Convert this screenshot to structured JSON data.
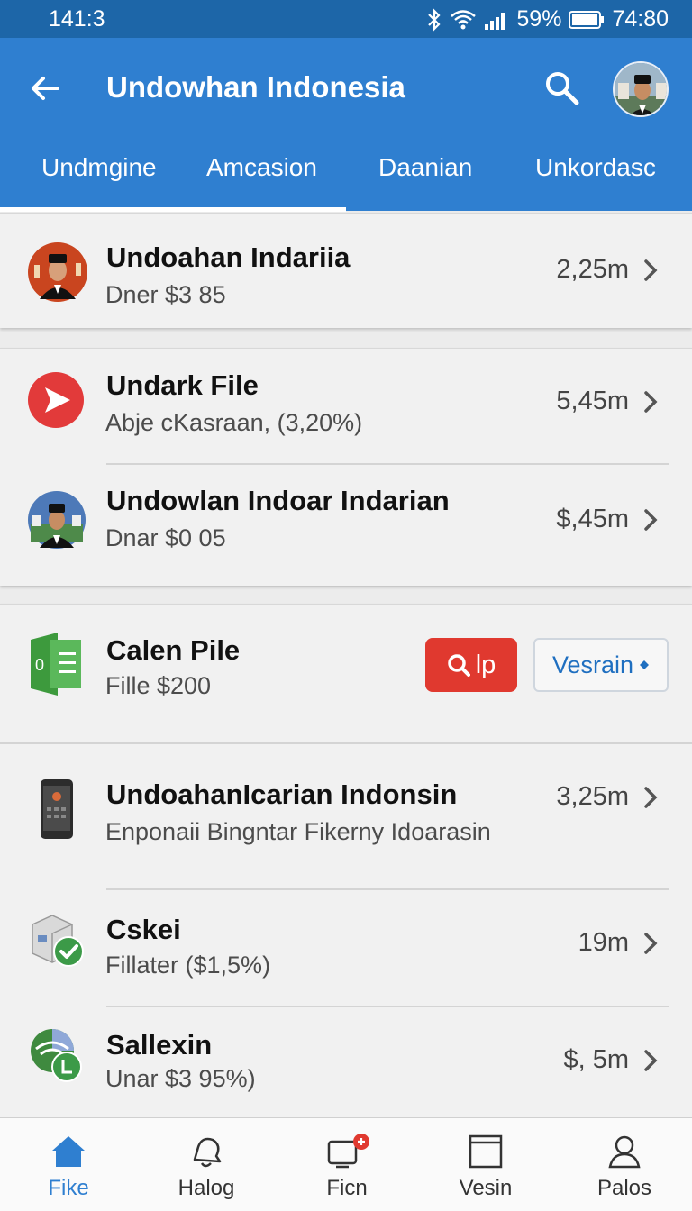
{
  "status": {
    "time": "141:3",
    "battery": "59%",
    "clock": "74:80"
  },
  "appbar": {
    "title": "Undowhan Indonesia"
  },
  "tabs": [
    "Undmgine",
    "Amcasion",
    "Daanian",
    "Unkordasc"
  ],
  "rows": [
    {
      "name": "Undoahan Indariia",
      "sub": "Dner  $3 85",
      "value": "2,25m",
      "icon": "portrait-icon"
    },
    {
      "name": "Undark File",
      "sub": "Abje cKasraan, (3,20%)",
      "value": "5,45m",
      "icon": "play-icon"
    },
    {
      "name": "Undowlan Indoar Indarian",
      "sub": "Dnar  $0 05",
      "value": "$,45m",
      "icon": "portrait-icon"
    },
    {
      "name": "Calen Pile",
      "sub": "Fille $200",
      "icon": "spreadsheet-icon"
    },
    {
      "name": "UndoahanIcarian Indonsin",
      "sub": "Enponaii  Bingntar Fikerny Idoarasin",
      "value": "3,25m",
      "icon": "phone-icon"
    },
    {
      "name": "Cskei",
      "sub": "Fillater ($1,5%)",
      "value": "19m",
      "icon": "box-check-icon"
    },
    {
      "name": "Sallexin",
      "sub": "Unar  $3 95%)",
      "value": "$, 5m",
      "icon": "globe-icon"
    }
  ],
  "actions": {
    "primary": "lp",
    "secondary": "Vesrain"
  },
  "bottomnav": [
    {
      "label": "Fike",
      "icon": "home-icon"
    },
    {
      "label": "Halog",
      "icon": "bell-icon"
    },
    {
      "label": "Ficn",
      "icon": "devices-icon"
    },
    {
      "label": "Vesin",
      "icon": "window-icon"
    },
    {
      "label": "Palos",
      "icon": "person-icon"
    }
  ],
  "colors": {
    "primary": "#2f7fd0",
    "statusbar": "#1d66a8",
    "danger": "#e0392f"
  }
}
